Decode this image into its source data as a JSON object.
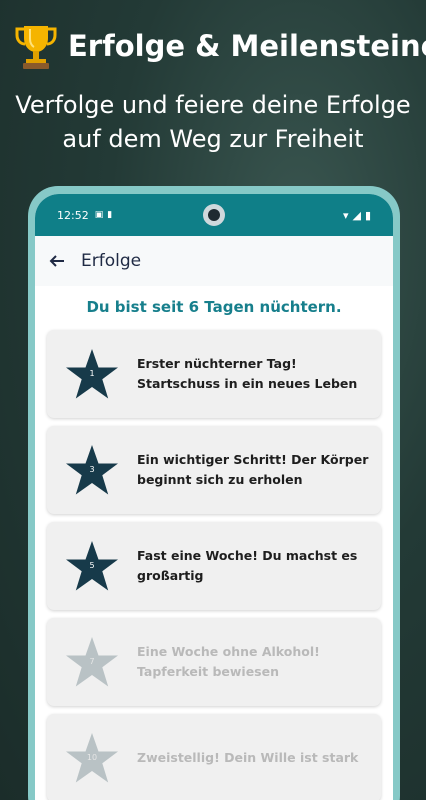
{
  "promo": {
    "title": "Erfolge & Meilensteine",
    "subtitle_line1": "Verfolge und feiere deine Erfolge",
    "subtitle_line2": "auf dem Weg zur Freiheit"
  },
  "statusbar": {
    "time": "12:52"
  },
  "appbar": {
    "title": "Erfolge"
  },
  "status_message": "Du bist seit 6 Tagen nüchtern.",
  "colors": {
    "accent": "#177f8c",
    "star_achieved": "#173a4a",
    "star_locked": "#b9c2c5"
  },
  "achievements": [
    {
      "days": "1",
      "text": "Erster nüchterner Tag! Startschuss in ein neues Leben",
      "achieved": true
    },
    {
      "days": "3",
      "text": "Ein wichtiger Schritt! Der Körper beginnt sich zu erholen",
      "achieved": true
    },
    {
      "days": "5",
      "text": "Fast eine Woche! Du machst es großartig",
      "achieved": true
    },
    {
      "days": "7",
      "text": "Eine Woche ohne Alkohol! Tapferkeit bewiesen",
      "achieved": false
    },
    {
      "days": "10",
      "text": "Zweistellig! Dein Wille ist stark",
      "achieved": false
    }
  ]
}
